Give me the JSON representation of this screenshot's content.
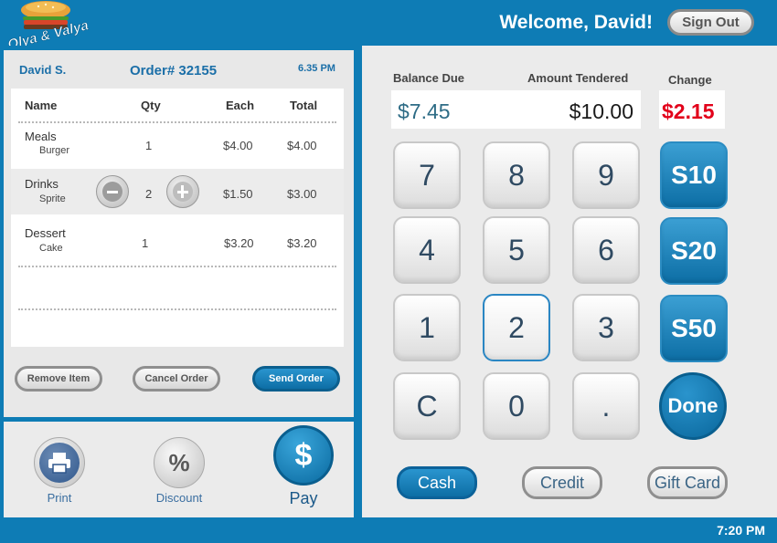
{
  "header": {
    "logo_text": "Olya & Valya",
    "welcome": "Welcome, David!",
    "sign_out": "Sign Out"
  },
  "order": {
    "customer": "David S.",
    "order_number": "Order# 32155",
    "time": "6.35 PM",
    "columns": [
      "Name",
      "Qty",
      "Each",
      "Total"
    ],
    "items": [
      {
        "category": "Meals",
        "name": "Burger",
        "qty": "1",
        "each": "$4.00",
        "total": "$4.00"
      },
      {
        "category": "Drinks",
        "name": "Sprite",
        "qty": "2",
        "each": "$1.50",
        "total": "$3.00"
      },
      {
        "category": "Dessert",
        "name": "Cake",
        "qty": "1",
        "each": "$3.20",
        "total": "$3.20"
      }
    ],
    "actions": {
      "remove": "Remove Item",
      "cancel": "Cancel Order",
      "send": "Send Order"
    }
  },
  "bottom_left": {
    "print": "Print",
    "discount": "Discount",
    "discount_symbol": "%",
    "pay_symbol": "$",
    "pay": "Pay"
  },
  "payment": {
    "balance_label": "Balance Due",
    "tendered_label": "Amount Tendered",
    "change_label": "Change",
    "balance": "$7.45",
    "tendered": "$10.00",
    "change": "$2.15",
    "keys": [
      "7",
      "8",
      "9",
      "4",
      "5",
      "6",
      "1",
      "2",
      "3",
      "C",
      "0",
      "."
    ],
    "quick": [
      "S10",
      "S20",
      "S50"
    ],
    "done": "Done",
    "methods": [
      "Cash",
      "Credit",
      "Gift Card"
    ],
    "selected_method": "Cash",
    "selected_key": "2"
  },
  "footer": {
    "time": "7:20 PM"
  },
  "colors": {
    "brand_blue": "#0e7cb5",
    "change_red": "#e2001a"
  }
}
